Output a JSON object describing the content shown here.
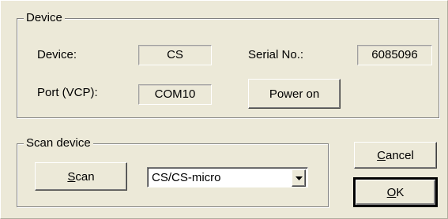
{
  "device_group": {
    "title": "Device",
    "device_label": "Device:",
    "device_value": "CS",
    "serial_label": "Serial No.:",
    "serial_value": "6085096",
    "port_label": "Port (VCP):",
    "port_value": "COM10",
    "power_button": "Power on"
  },
  "scan_group": {
    "title": "Scan device",
    "scan_button_mnemonic": "S",
    "scan_button_rest": "can",
    "device_type_selected": "CS/CS-micro"
  },
  "buttons": {
    "cancel_mnemonic": "C",
    "cancel_rest": "ancel",
    "ok_mnemonic": "O",
    "ok_rest": "K"
  },
  "icons": {
    "dropdown": "chevron-down-icon"
  }
}
